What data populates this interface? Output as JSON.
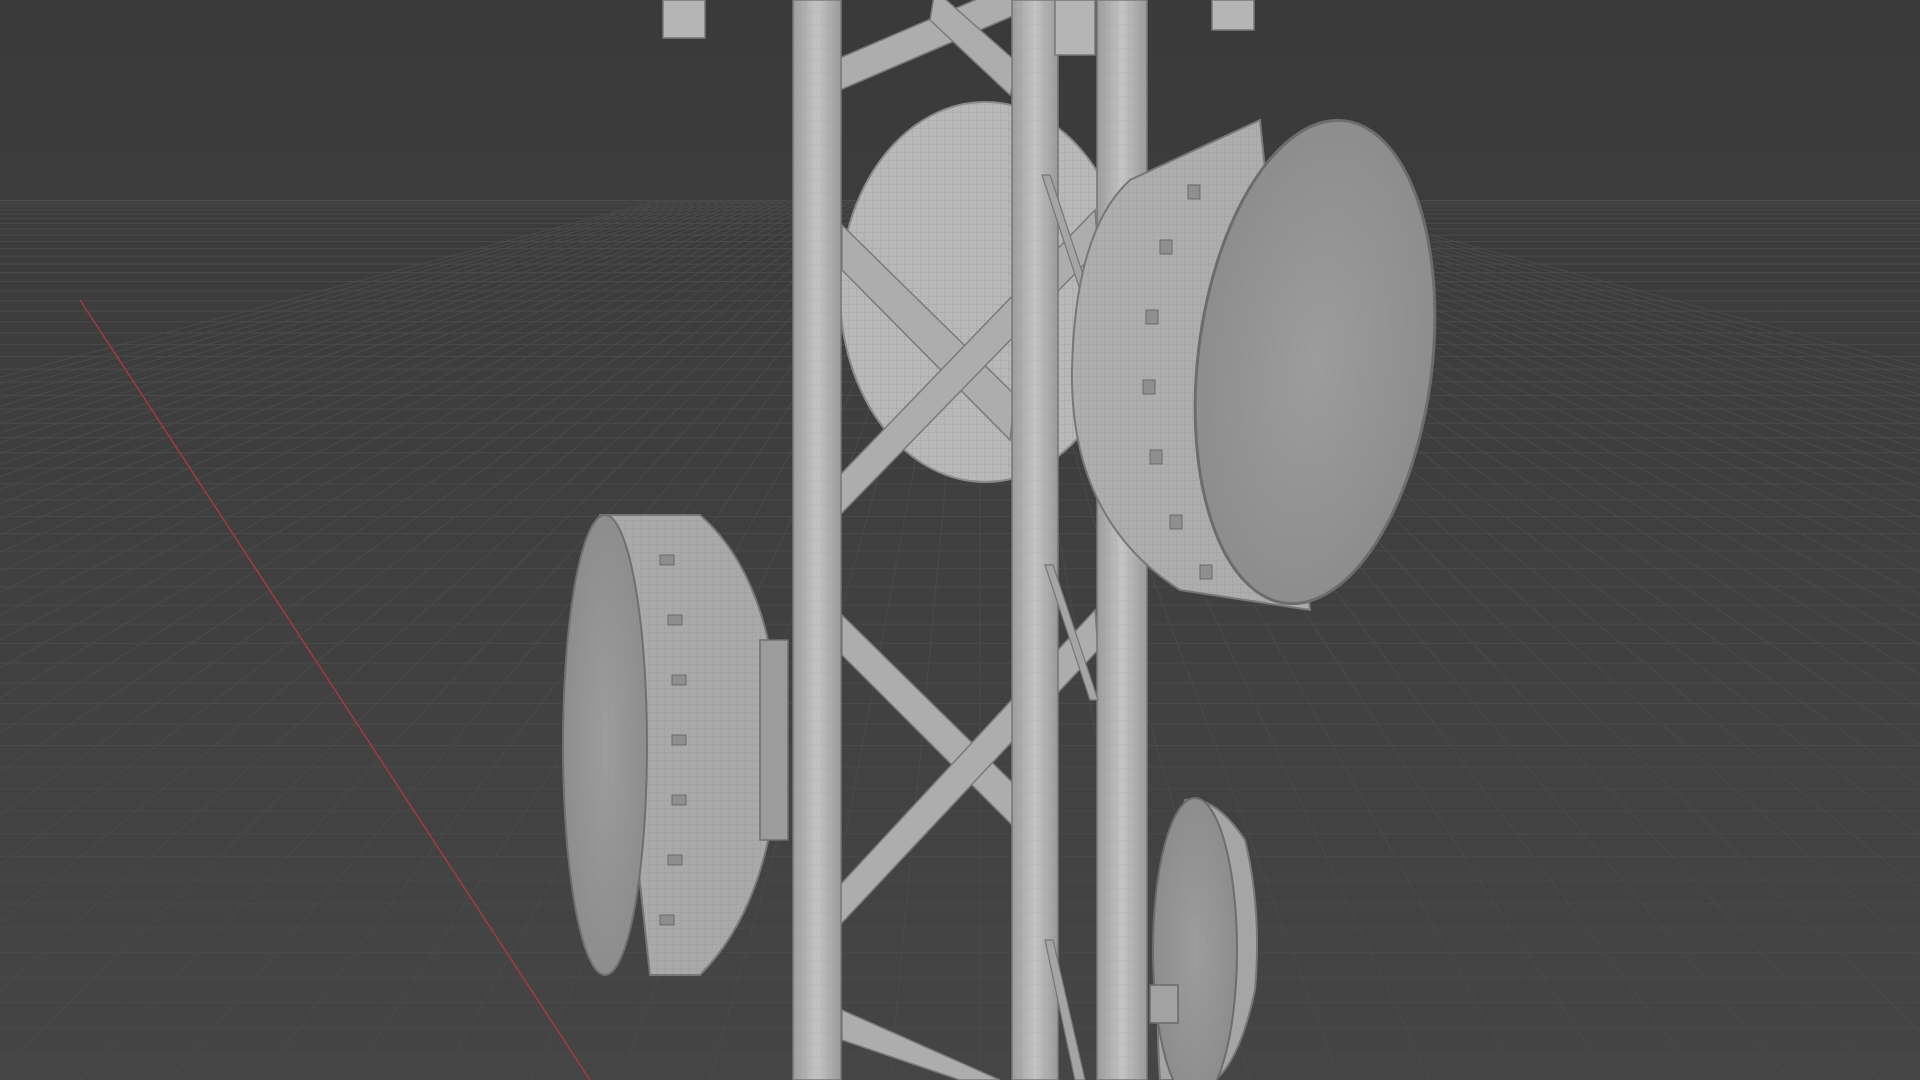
{
  "app": {
    "mode": "3d-viewport",
    "shading": "solid-wireframe"
  },
  "scene": {
    "objects": [
      {
        "name": "lattice-tower",
        "icon": "tower-icon"
      },
      {
        "name": "dish-antenna-rear"
      },
      {
        "name": "dish-antenna-right-upper"
      },
      {
        "name": "dish-antenna-left"
      },
      {
        "name": "dish-antenna-right-lower"
      }
    ]
  },
  "colors": {
    "background": "#3b3b3b",
    "grid_line": "#4a4a4a",
    "x_axis": "#a13a44",
    "model_light": "#bdbdbd",
    "model_mid": "#a6a6a6",
    "model_dark": "#7d7d7d",
    "edge": "#6a6a6a"
  }
}
